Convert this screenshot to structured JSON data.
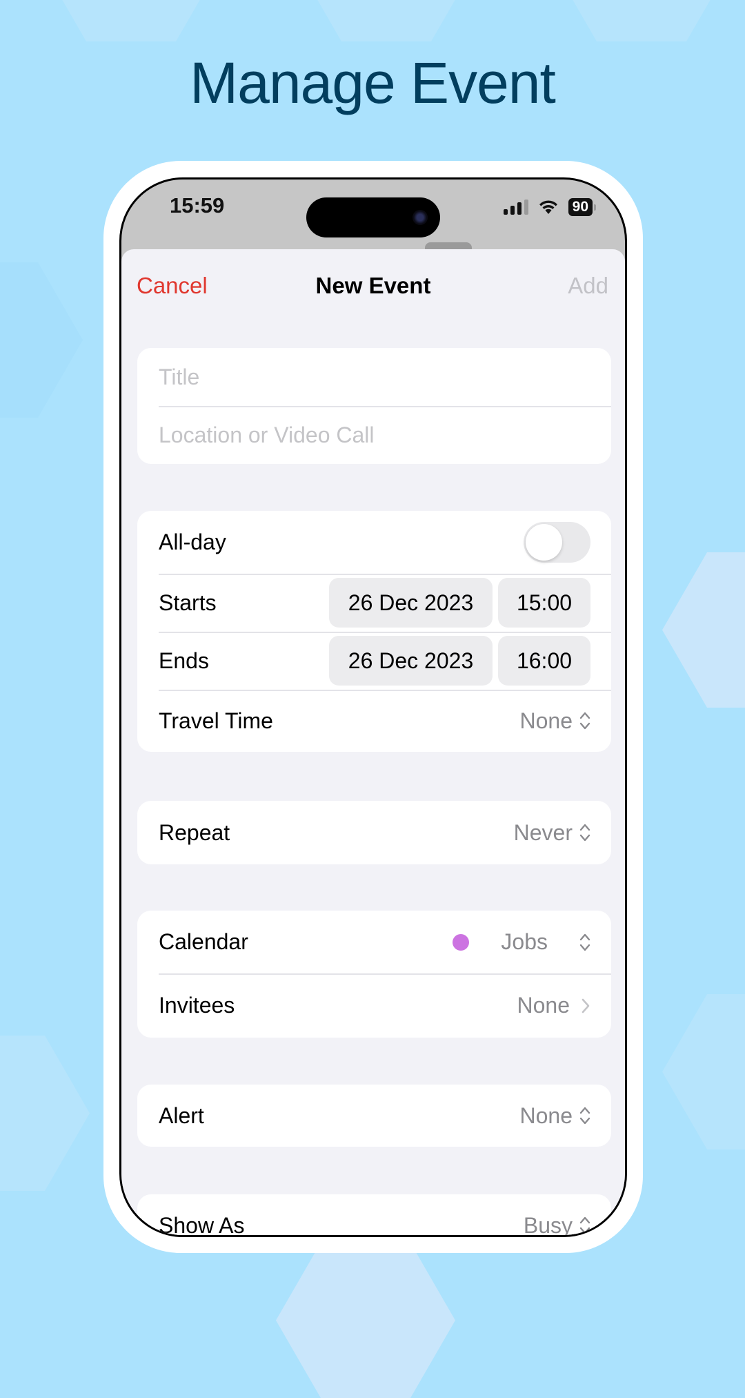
{
  "promo": {
    "title": "Manage Event"
  },
  "status_bar": {
    "time": "15:59",
    "battery": "90"
  },
  "nav": {
    "cancel": "Cancel",
    "title": "New Event",
    "add": "Add"
  },
  "title_section": {
    "title_placeholder": "Title",
    "location_placeholder": "Location or Video Call"
  },
  "timing": {
    "all_day_label": "All-day",
    "all_day_on": false,
    "starts_label": "Starts",
    "starts_date": "26 Dec 2023",
    "starts_time": "15:00",
    "ends_label": "Ends",
    "ends_date": "26 Dec 2023",
    "ends_time": "16:00",
    "travel_label": "Travel Time",
    "travel_value": "None"
  },
  "repeat": {
    "label": "Repeat",
    "value": "Never"
  },
  "calendar": {
    "label": "Calendar",
    "value": "Jobs",
    "color": "#cc73e1",
    "invitees_label": "Invitees",
    "invitees_value": "None"
  },
  "alert": {
    "label": "Alert",
    "value": "None"
  },
  "show_as": {
    "label": "Show As",
    "value": "Busy"
  },
  "colors": {
    "accent_cancel": "#e0382f",
    "title_color": "#023e5e"
  }
}
